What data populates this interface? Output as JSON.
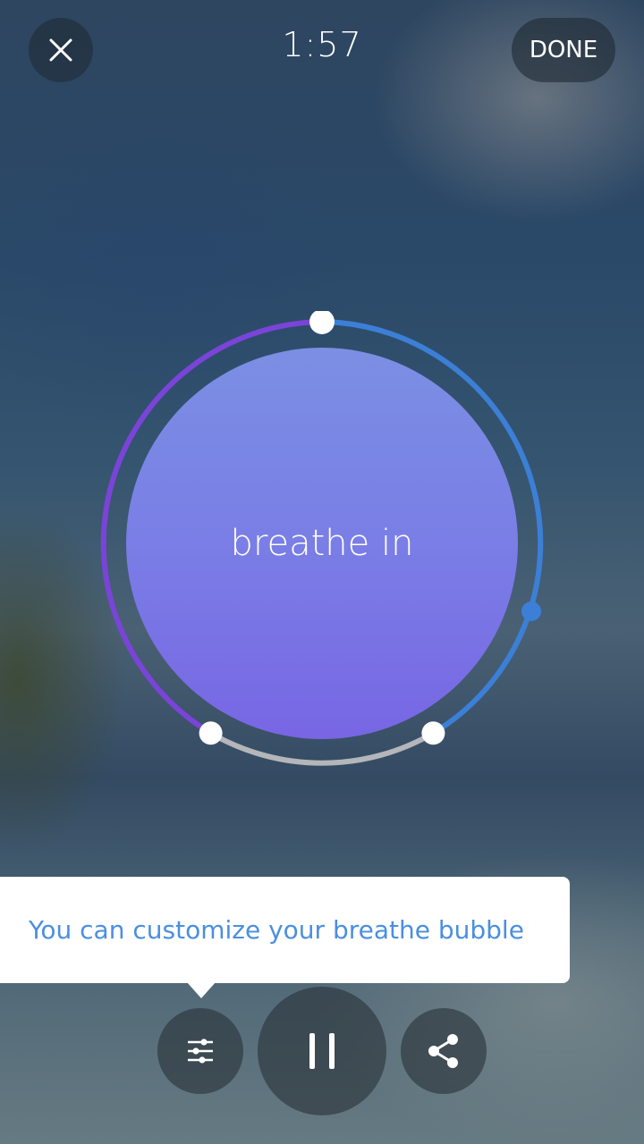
{
  "header": {
    "timer": "1:57",
    "done_label": "DONE"
  },
  "breath": {
    "prompt": "breathe in"
  },
  "tooltip": {
    "text": "You can customize your breathe bubble"
  },
  "controls": {
    "settings_icon": "sliders-icon",
    "pause_icon": "pause-icon",
    "share_icon": "share-icon",
    "close_icon": "close-icon"
  },
  "colors": {
    "ring_inhale": "#7a44d8",
    "ring_exhale": "#3c7fd6",
    "ring_hold": "#b4b6ba",
    "bubble": "#7a7ee6",
    "tooltip_text": "#4a8fe0"
  }
}
